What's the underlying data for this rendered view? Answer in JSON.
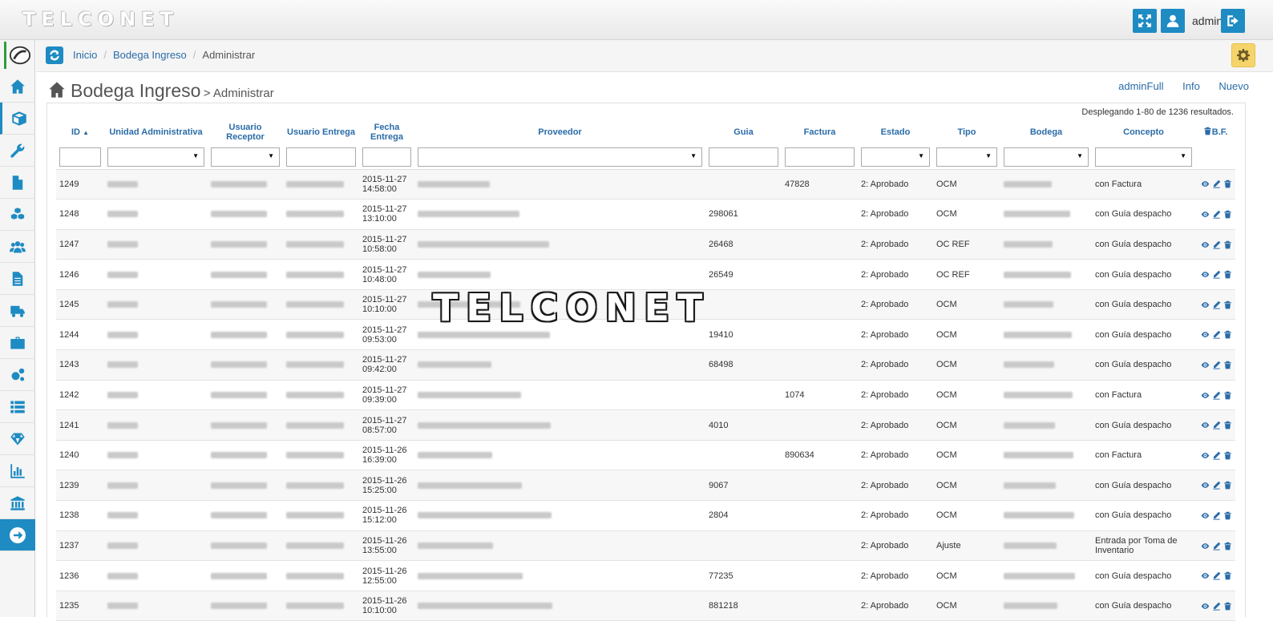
{
  "app": {
    "brand": "TELCONET",
    "user": "admin"
  },
  "breadcrumb": [
    "Inicio",
    "Bodega Ingreso",
    "Administrar"
  ],
  "page": {
    "title": "Bodega Ingreso",
    "subtitle": "> Administrar"
  },
  "top_links": [
    "adminFull",
    "Info",
    "Nuevo"
  ],
  "summary": "Desplegando 1-80 de 1236 resultados.",
  "watermark": "TELCONET",
  "columns": [
    "ID",
    "Unidad Administrativa",
    "Usuario Receptor",
    "Usuario Entrega",
    "Fecha Entrega",
    "Proveedor",
    "Guia",
    "Factura",
    "Estado",
    "Tipo",
    "Bodega",
    "Concepto",
    "B.F."
  ],
  "sidebar_icons": [
    "home-icon",
    "cube-icon",
    "wrench-icon",
    "file-icon",
    "cubes-icon",
    "users-icon",
    "document-icon",
    "truck-icon",
    "briefcase-icon",
    "cogs-icon",
    "list-icon",
    "diamond-icon",
    "bar-chart-icon",
    "bank-icon",
    "arrow-circle-right-icon"
  ],
  "rows": [
    {
      "id": "1249",
      "date": "2015-11-27",
      "time": "14:58:00",
      "guia": "",
      "factura": "47828",
      "estado": "2: Aprobado",
      "tipo": "OCM",
      "concepto": "con Factura"
    },
    {
      "id": "1248",
      "date": "2015-11-27",
      "time": "13:10:00",
      "guia": "298061",
      "factura": "",
      "estado": "2: Aprobado",
      "tipo": "OCM",
      "concepto": "con Guía despacho"
    },
    {
      "id": "1247",
      "date": "2015-11-27",
      "time": "10:58:00",
      "guia": "26468",
      "factura": "",
      "estado": "2: Aprobado",
      "tipo": "OC REF",
      "concepto": "con Guía despacho"
    },
    {
      "id": "1246",
      "date": "2015-11-27",
      "time": "10:48:00",
      "guia": "26549",
      "factura": "",
      "estado": "2: Aprobado",
      "tipo": "OC REF",
      "concepto": "con Guía despacho"
    },
    {
      "id": "1245",
      "date": "2015-11-27",
      "time": "10:10:00",
      "guia": "",
      "factura": "",
      "estado": "2: Aprobado",
      "tipo": "OCM",
      "concepto": "con Guía despacho"
    },
    {
      "id": "1244",
      "date": "2015-11-27",
      "time": "09:53:00",
      "guia": "19410",
      "factura": "",
      "estado": "2: Aprobado",
      "tipo": "OCM",
      "concepto": "con Guía despacho"
    },
    {
      "id": "1243",
      "date": "2015-11-27",
      "time": "09:42:00",
      "guia": "68498",
      "factura": "",
      "estado": "2: Aprobado",
      "tipo": "OCM",
      "concepto": "con Guía despacho"
    },
    {
      "id": "1242",
      "date": "2015-11-27",
      "time": "09:39:00",
      "guia": "",
      "factura": "1074",
      "estado": "2: Aprobado",
      "tipo": "OCM",
      "concepto": "con Factura"
    },
    {
      "id": "1241",
      "date": "2015-11-27",
      "time": "08:57:00",
      "guia": "4010",
      "factura": "",
      "estado": "2: Aprobado",
      "tipo": "OCM",
      "concepto": "con Guía despacho"
    },
    {
      "id": "1240",
      "date": "2015-11-26",
      "time": "16:39:00",
      "guia": "",
      "factura": "890634",
      "estado": "2: Aprobado",
      "tipo": "OCM",
      "concepto": "con Factura"
    },
    {
      "id": "1239",
      "date": "2015-11-26",
      "time": "15:25:00",
      "guia": "9067",
      "factura": "",
      "estado": "2: Aprobado",
      "tipo": "OCM",
      "concepto": "con Guía despacho"
    },
    {
      "id": "1238",
      "date": "2015-11-26",
      "time": "15:12:00",
      "guia": "2804",
      "factura": "",
      "estado": "2: Aprobado",
      "tipo": "OCM",
      "concepto": "con Guía despacho"
    },
    {
      "id": "1237",
      "date": "2015-11-26",
      "time": "13:55:00",
      "guia": "",
      "factura": "",
      "estado": "2: Aprobado",
      "tipo": "Ajuste",
      "concepto": "Entrada por Toma de Inventario"
    },
    {
      "id": "1236",
      "date": "2015-11-26",
      "time": "12:55:00",
      "guia": "77235",
      "factura": "",
      "estado": "2: Aprobado",
      "tipo": "OCM",
      "concepto": "con Guía despacho"
    },
    {
      "id": "1235",
      "date": "2015-11-26",
      "time": "10:10:00",
      "guia": "881218",
      "factura": "",
      "estado": "2: Aprobado",
      "tipo": "OCM",
      "concepto": "con Guía despacho"
    }
  ]
}
